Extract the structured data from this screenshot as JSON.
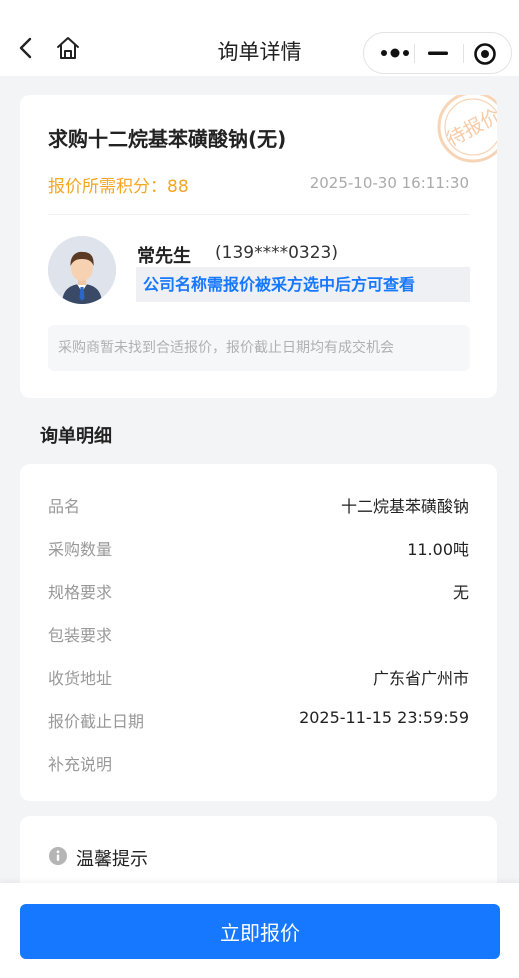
{
  "nav": {
    "title": "询单详情",
    "icons": {
      "back": "chevron-left-icon",
      "home": "home-icon",
      "more": "more-dots-icon",
      "minimize": "minimize-icon",
      "close": "close-target-icon"
    }
  },
  "inquiry": {
    "product_title": "求购十二烷基苯磺酸钠(无)",
    "points_label": "报价所需积分：",
    "points_value": "88",
    "created_time": "2025-10-30 16:11:30",
    "stamp_text": "待报价",
    "buyer_name": "常先生",
    "buyer_phone": "(139****0323)",
    "company_hint": "公司名称需报价被采方选中后方可查看",
    "notice": "采购商暂未找到合适报价，报价截止日期均有成交机会"
  },
  "detail": {
    "section_title": "询单明细",
    "rows": [
      {
        "label": "品名",
        "value": "十二烷基苯磺酸钠"
      },
      {
        "label": "采购数量",
        "value": "11.00吨"
      },
      {
        "label": "规格要求",
        "value": "无"
      },
      {
        "label": "包装要求",
        "value": ""
      },
      {
        "label": "收货地址",
        "value": "广东省广州市"
      },
      {
        "label": "报价截止日期",
        "value": "2025-11-15 23:59:59"
      },
      {
        "label": "补充说明",
        "value": ""
      }
    ]
  },
  "tip": {
    "title": "温馨提示"
  },
  "action": {
    "quote_label": "立即报价"
  },
  "colors": {
    "accent": "#1677ff",
    "points": "#f5a623",
    "stamp": "#f5c9a0",
    "background": "#f3f4f6"
  }
}
